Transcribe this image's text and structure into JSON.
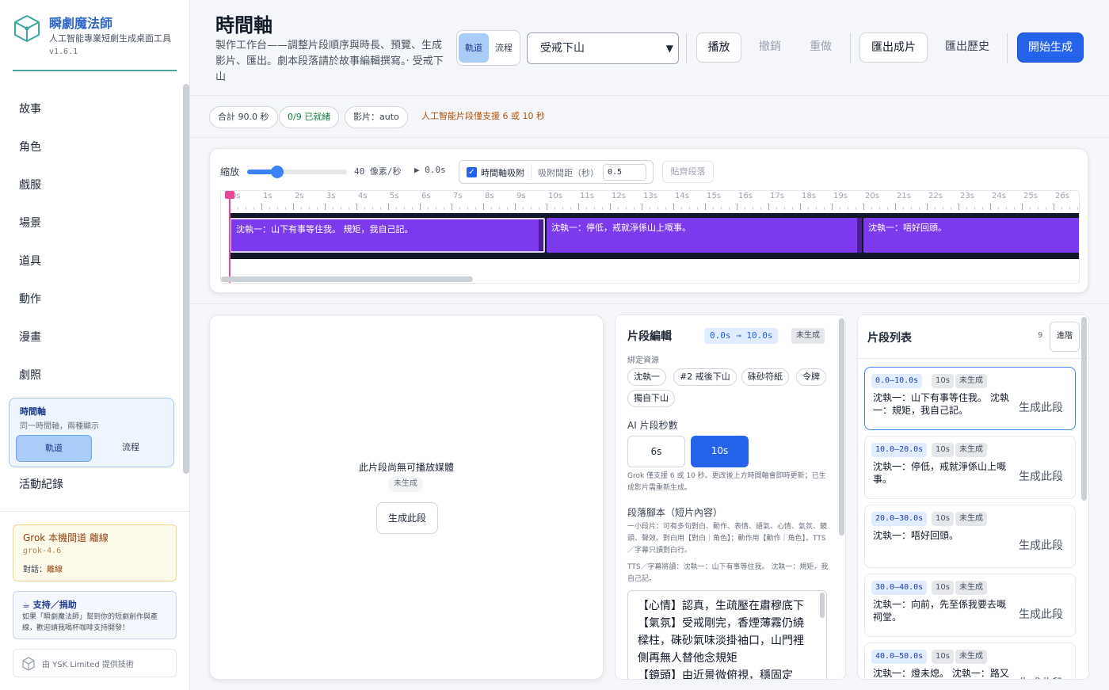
{
  "brand": {
    "title": "瞬劇魔法師",
    "subtitle": "人工智能專業短劇生成桌面工具",
    "version": "v1.6.1"
  },
  "nav": {
    "items": [
      "故事",
      "角色",
      "戲服",
      "場景",
      "道具",
      "動作",
      "漫畫",
      "劇照"
    ],
    "timeline_card": {
      "title": "時間軸",
      "subtitle": "同一時間軸，兩種顯示",
      "track": "軌道",
      "flow": "流程"
    },
    "log": "活動紀錄"
  },
  "grok": {
    "title": "Grok 本機間道 離線",
    "model": "grok-4.6",
    "status_label": "對話：",
    "status_value": "離線"
  },
  "support": {
    "title": "☕ 支持／捐助",
    "text": "如果「瞬劇魔法師」幫到你的短劇創作與產線，歡迎請我喝杯咖啡支持開發！"
  },
  "credit": {
    "text": "由 YSK Limited 提供技術"
  },
  "header": {
    "title": "時間軸",
    "description": "製作工作台——調整片段順序與時長、預覽、生成影片、匯出。劇本段落請於故事編輯撰寫。· 受戒下山",
    "view_track": "軌道",
    "view_flow": "流程",
    "story_select": "受戒下山",
    "play": "播放",
    "undo": "撤銷",
    "redo": "重做",
    "export": "匯出成片",
    "history": "匯出歷史",
    "start": "開始生成"
  },
  "chips": {
    "total": "合計 90.0 秒",
    "ready": "0/9 已就緒",
    "video": "影片：auto",
    "warning": "人工智能片段僅支援 6 或 10 秒"
  },
  "timeline": {
    "zoom_label": "縮放",
    "zoom_value": "40 像素/秒",
    "zoom_fraction": 0.3,
    "play_position": "▶ 0.0s",
    "snap_label": "時間軸吸附",
    "snap_gap_label": "吸附間距（秒）",
    "snap_gap_value": "0.5",
    "align_button": "貼齊段落",
    "ticks": [
      "0s",
      "1s",
      "2s",
      "3s",
      "4s",
      "5s",
      "6s",
      "7s",
      "8s",
      "9s",
      "10s",
      "11s",
      "12s",
      "13s",
      "14s",
      "15s",
      "16s",
      "17s",
      "18s",
      "19s",
      "20s",
      "21s",
      "22s",
      "23s",
      "24s",
      "25s",
      "26s"
    ],
    "clips": [
      {
        "label": "沈執一：山下有事等住我。 規矩，我自己記。",
        "start": 0,
        "end": 10
      },
      {
        "label": "沈執一：停低，戒就淨係山上嘅事。",
        "start": 10,
        "end": 20
      },
      {
        "label": "沈執一：唔好回頭。",
        "start": 20,
        "end": 30
      }
    ]
  },
  "preview": {
    "message": "此片段尚無可播放媒體",
    "badge": "未生成",
    "generate": "生成此段"
  },
  "editor": {
    "title": "片段編輯",
    "time_range": "0.0s → 10.0s",
    "status": "未生成",
    "resources_label": "綁定資源",
    "resources": [
      "沈執一",
      "#2 戒後下山",
      "硃砂符紙",
      "令牌",
      "獨自下山"
    ],
    "ai_label": "AI 片段秒數",
    "opt_6s": "6s",
    "opt_10s": "10s",
    "note": "Grok 僅支援 6 或 10 秒。更改後上方時間軸會即時更新；已生成影片需重新生成。",
    "script_label": "段落腳本（短片內容）",
    "script_hint": "一小段片：可有多句對白、動作、表情、語氣、心情、氣氛、鏡頭、聲效。對白用【對白｜角色】；動作用【動作｜角色】。TTS／字幕只讀對白行。",
    "tts": "TTS／字幕將讀：沈執一：山下有事等住我。 沈執一：規矩，我自己記。",
    "script_lines": [
      "【心情】認真，生疏壓在肅穆底下",
      "【氣氛】受戒剛完，香煙薄霧仍繞樑柱，硃砂氣味淡掛袖口，山門裡側再無人替他念規矩",
      "【鏡頭】由近景微俯視，穩固定"
    ]
  },
  "cliplist": {
    "title": "片段列表",
    "count": "9",
    "advanced": "進階",
    "generate_label": "生成此段",
    "items": [
      {
        "range": "0.0–10.0s",
        "duration": "10s",
        "status": "未生成",
        "text": "沈執一：山下有事等住我。 沈執一：規矩，我自己記。"
      },
      {
        "range": "10.0–20.0s",
        "duration": "10s",
        "status": "未生成",
        "text": "沈執一：停低，戒就淨係山上嘅事。"
      },
      {
        "range": "20.0–30.0s",
        "duration": "10s",
        "status": "未生成",
        "text": "沈執一：唔好回頭。"
      },
      {
        "range": "30.0–40.0s",
        "duration": "10s",
        "status": "未生成",
        "text": "沈執一：向前，先至係我要去嘅祠堂。"
      },
      {
        "range": "40.0–50.0s",
        "duration": "10s",
        "status": "未生成",
        "text": "沈執一：燈未熄。 沈執一：路又"
      }
    ]
  }
}
